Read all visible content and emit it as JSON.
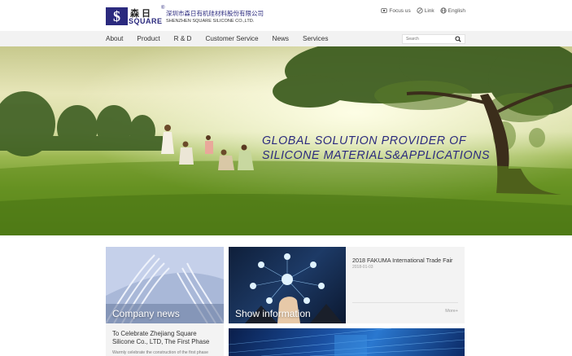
{
  "brand": {
    "logo_cn": "森日",
    "logo_en": "SQUARE",
    "reg": "®",
    "company_cn": "深圳市森日有机硅材料股份有限公司",
    "company_en": "SHENZHEN SQUARE SILICONE CO.,LTD.",
    "color": "#2b2a7e"
  },
  "top_links": [
    {
      "label": "Focus us",
      "icon": "follow-icon"
    },
    {
      "label": "Link",
      "icon": "link-icon"
    },
    {
      "label": "English",
      "icon": "globe-icon"
    }
  ],
  "nav": {
    "items": [
      "About",
      "Product",
      "R & D",
      "Customer Service",
      "News",
      "Services"
    ],
    "search_placeholder": "Search"
  },
  "banner": {
    "slogan_line1": "GLOBAL SOLUTION PROVIDER OF",
    "slogan_line2": "SILICONE MATERIALS&APPLICATIONS"
  },
  "cards": {
    "company_news_label": "Company news",
    "show_info_label": "Show information",
    "news_title": "2018 FAKUMA International Trade Fair",
    "news_date": "2018-01-03",
    "more": "More+",
    "company_news_title": "To Celebrate Zhejiang Square Silicone Co., LTD, The First Phase",
    "company_news_summary": "Warmly celebrate the construction of the first phase"
  }
}
